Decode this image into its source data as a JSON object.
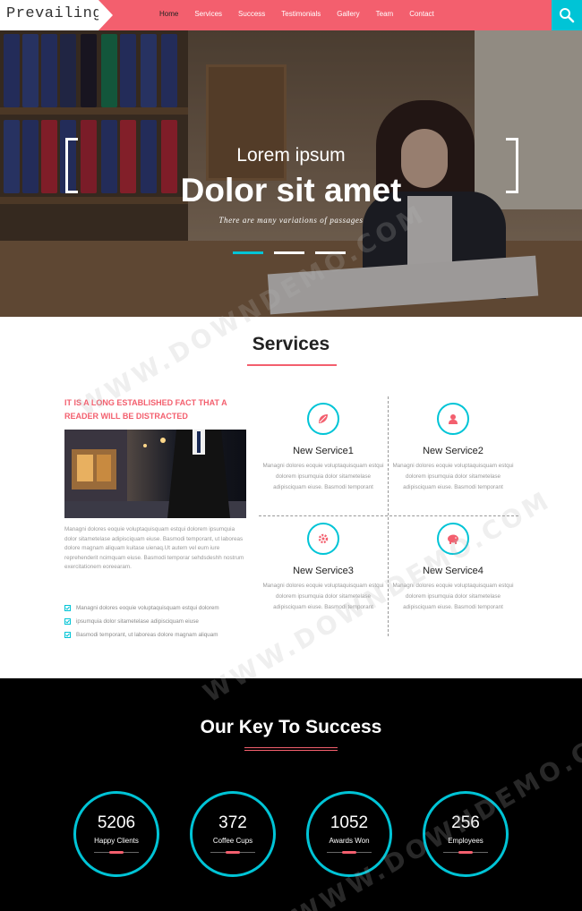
{
  "header": {
    "logo": "Prevailing",
    "nav": [
      "Home",
      "Services",
      "Success",
      "Testimonials",
      "Gallery",
      "Team",
      "Contact"
    ],
    "active_nav": "Home",
    "search_icon": "search-icon"
  },
  "hero": {
    "subtitle": "Lorem ipsum",
    "title": "Dolor sit amet",
    "caption": "There are many variations of passages",
    "slides": 3,
    "active_slide": 1
  },
  "services": {
    "title": "Services",
    "intro_heading": "IT IS A LONG ESTABLISHED FACT THAT A READER WILL BE DISTRACTED",
    "intro_text": "Managni dolores eoquie voluptaquisquam estqui dolorem ipsumquia dolor sitametelase adipisciquam eiuse. Basmodi temporant, ut laboreas dolore magnam aliquam kuitase uienaq.Ut autem vel eum iure reprehenderit ncimquam eiuse. Basmodi temporar sehdsdeshh nostrum exercitationem eoreearam.",
    "checklist": [
      "Managni dolores eoquie voluptaquisquam estqui dolorem",
      "ipsumquia dolor sitametelase adipisciquam eiuse",
      "Basmodi temporant, ut laboreas dolore magnam aliquam"
    ],
    "items": [
      {
        "name": "New Service1",
        "icon": "leaf-icon",
        "desc": "Managni dolores eoquie voluptaquisquam estqui dolorem ipsumquia dolor sitametelase adipisciquam eiuse. Basmodi temporant"
      },
      {
        "name": "New Service2",
        "icon": "user-icon",
        "desc": "Managni dolores eoquie voluptaquisquam estqui dolorem ipsumquia dolor sitametelase adipisciquam eiuse. Basmodi temporant"
      },
      {
        "name": "New Service3",
        "icon": "gear-icon",
        "desc": "Managni dolores eoquie voluptaquisquam estqui dolorem ipsumquia dolor sitametelase adipisciquam eiuse. Basmodi temporant"
      },
      {
        "name": "New Service4",
        "icon": "piggy-bank-icon",
        "desc": "Managni dolores eoquie voluptaquisquam estqui dolorem ipsumquia dolor sitametelase adipisciquam eiuse. Basmodi temporant"
      }
    ]
  },
  "success": {
    "title": "Our Key To Success",
    "counters": [
      {
        "value": "5206",
        "label": "Happy Clients"
      },
      {
        "value": "372",
        "label": "Coffee Cups"
      },
      {
        "value": "1052",
        "label": "Awards Won"
      },
      {
        "value": "256",
        "label": "Employees"
      }
    ]
  },
  "watermark": "WWW.DOWNDEMO.COM",
  "colors": {
    "accent": "#f35f6e",
    "teal": "#00c4d6",
    "dark": "#000000"
  }
}
